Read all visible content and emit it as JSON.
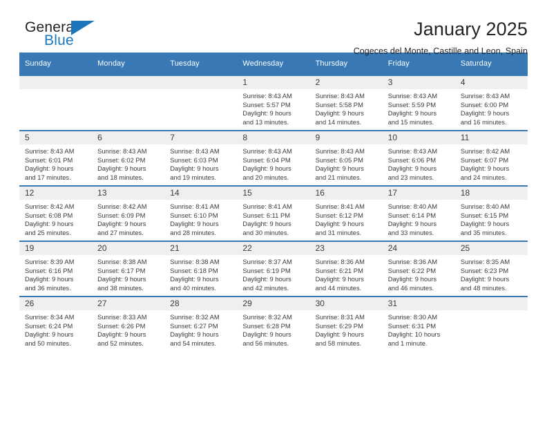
{
  "brand": {
    "name_top": "General",
    "name_bottom": "Blue",
    "accent_color": "#1b76bb"
  },
  "header": {
    "title": "January 2025",
    "subtitle": "Cogeces del Monte, Castille and Leon, Spain"
  },
  "theme": {
    "header_row_bg": "#3778b5",
    "daynum_band_bg": "#efefef",
    "text_color": "#3a3a3a"
  },
  "calendar": {
    "weekday_headers": [
      "Sunday",
      "Monday",
      "Tuesday",
      "Wednesday",
      "Thursday",
      "Friday",
      "Saturday"
    ],
    "weeks": [
      [
        {
          "day": "",
          "lines": []
        },
        {
          "day": "",
          "lines": []
        },
        {
          "day": "",
          "lines": []
        },
        {
          "day": "1",
          "lines": [
            "Sunrise: 8:43 AM",
            "Sunset: 5:57 PM",
            "Daylight: 9 hours",
            "and 13 minutes."
          ]
        },
        {
          "day": "2",
          "lines": [
            "Sunrise: 8:43 AM",
            "Sunset: 5:58 PM",
            "Daylight: 9 hours",
            "and 14 minutes."
          ]
        },
        {
          "day": "3",
          "lines": [
            "Sunrise: 8:43 AM",
            "Sunset: 5:59 PM",
            "Daylight: 9 hours",
            "and 15 minutes."
          ]
        },
        {
          "day": "4",
          "lines": [
            "Sunrise: 8:43 AM",
            "Sunset: 6:00 PM",
            "Daylight: 9 hours",
            "and 16 minutes."
          ]
        }
      ],
      [
        {
          "day": "5",
          "lines": [
            "Sunrise: 8:43 AM",
            "Sunset: 6:01 PM",
            "Daylight: 9 hours",
            "and 17 minutes."
          ]
        },
        {
          "day": "6",
          "lines": [
            "Sunrise: 8:43 AM",
            "Sunset: 6:02 PM",
            "Daylight: 9 hours",
            "and 18 minutes."
          ]
        },
        {
          "day": "7",
          "lines": [
            "Sunrise: 8:43 AM",
            "Sunset: 6:03 PM",
            "Daylight: 9 hours",
            "and 19 minutes."
          ]
        },
        {
          "day": "8",
          "lines": [
            "Sunrise: 8:43 AM",
            "Sunset: 6:04 PM",
            "Daylight: 9 hours",
            "and 20 minutes."
          ]
        },
        {
          "day": "9",
          "lines": [
            "Sunrise: 8:43 AM",
            "Sunset: 6:05 PM",
            "Daylight: 9 hours",
            "and 21 minutes."
          ]
        },
        {
          "day": "10",
          "lines": [
            "Sunrise: 8:43 AM",
            "Sunset: 6:06 PM",
            "Daylight: 9 hours",
            "and 23 minutes."
          ]
        },
        {
          "day": "11",
          "lines": [
            "Sunrise: 8:42 AM",
            "Sunset: 6:07 PM",
            "Daylight: 9 hours",
            "and 24 minutes."
          ]
        }
      ],
      [
        {
          "day": "12",
          "lines": [
            "Sunrise: 8:42 AM",
            "Sunset: 6:08 PM",
            "Daylight: 9 hours",
            "and 25 minutes."
          ]
        },
        {
          "day": "13",
          "lines": [
            "Sunrise: 8:42 AM",
            "Sunset: 6:09 PM",
            "Daylight: 9 hours",
            "and 27 minutes."
          ]
        },
        {
          "day": "14",
          "lines": [
            "Sunrise: 8:41 AM",
            "Sunset: 6:10 PM",
            "Daylight: 9 hours",
            "and 28 minutes."
          ]
        },
        {
          "day": "15",
          "lines": [
            "Sunrise: 8:41 AM",
            "Sunset: 6:11 PM",
            "Daylight: 9 hours",
            "and 30 minutes."
          ]
        },
        {
          "day": "16",
          "lines": [
            "Sunrise: 8:41 AM",
            "Sunset: 6:12 PM",
            "Daylight: 9 hours",
            "and 31 minutes."
          ]
        },
        {
          "day": "17",
          "lines": [
            "Sunrise: 8:40 AM",
            "Sunset: 6:14 PM",
            "Daylight: 9 hours",
            "and 33 minutes."
          ]
        },
        {
          "day": "18",
          "lines": [
            "Sunrise: 8:40 AM",
            "Sunset: 6:15 PM",
            "Daylight: 9 hours",
            "and 35 minutes."
          ]
        }
      ],
      [
        {
          "day": "19",
          "lines": [
            "Sunrise: 8:39 AM",
            "Sunset: 6:16 PM",
            "Daylight: 9 hours",
            "and 36 minutes."
          ]
        },
        {
          "day": "20",
          "lines": [
            "Sunrise: 8:38 AM",
            "Sunset: 6:17 PM",
            "Daylight: 9 hours",
            "and 38 minutes."
          ]
        },
        {
          "day": "21",
          "lines": [
            "Sunrise: 8:38 AM",
            "Sunset: 6:18 PM",
            "Daylight: 9 hours",
            "and 40 minutes."
          ]
        },
        {
          "day": "22",
          "lines": [
            "Sunrise: 8:37 AM",
            "Sunset: 6:19 PM",
            "Daylight: 9 hours",
            "and 42 minutes."
          ]
        },
        {
          "day": "23",
          "lines": [
            "Sunrise: 8:36 AM",
            "Sunset: 6:21 PM",
            "Daylight: 9 hours",
            "and 44 minutes."
          ]
        },
        {
          "day": "24",
          "lines": [
            "Sunrise: 8:36 AM",
            "Sunset: 6:22 PM",
            "Daylight: 9 hours",
            "and 46 minutes."
          ]
        },
        {
          "day": "25",
          "lines": [
            "Sunrise: 8:35 AM",
            "Sunset: 6:23 PM",
            "Daylight: 9 hours",
            "and 48 minutes."
          ]
        }
      ],
      [
        {
          "day": "26",
          "lines": [
            "Sunrise: 8:34 AM",
            "Sunset: 6:24 PM",
            "Daylight: 9 hours",
            "and 50 minutes."
          ]
        },
        {
          "day": "27",
          "lines": [
            "Sunrise: 8:33 AM",
            "Sunset: 6:26 PM",
            "Daylight: 9 hours",
            "and 52 minutes."
          ]
        },
        {
          "day": "28",
          "lines": [
            "Sunrise: 8:32 AM",
            "Sunset: 6:27 PM",
            "Daylight: 9 hours",
            "and 54 minutes."
          ]
        },
        {
          "day": "29",
          "lines": [
            "Sunrise: 8:32 AM",
            "Sunset: 6:28 PM",
            "Daylight: 9 hours",
            "and 56 minutes."
          ]
        },
        {
          "day": "30",
          "lines": [
            "Sunrise: 8:31 AM",
            "Sunset: 6:29 PM",
            "Daylight: 9 hours",
            "and 58 minutes."
          ]
        },
        {
          "day": "31",
          "lines": [
            "Sunrise: 8:30 AM",
            "Sunset: 6:31 PM",
            "Daylight: 10 hours",
            "and 1 minute."
          ]
        },
        {
          "day": "",
          "lines": []
        }
      ]
    ]
  }
}
